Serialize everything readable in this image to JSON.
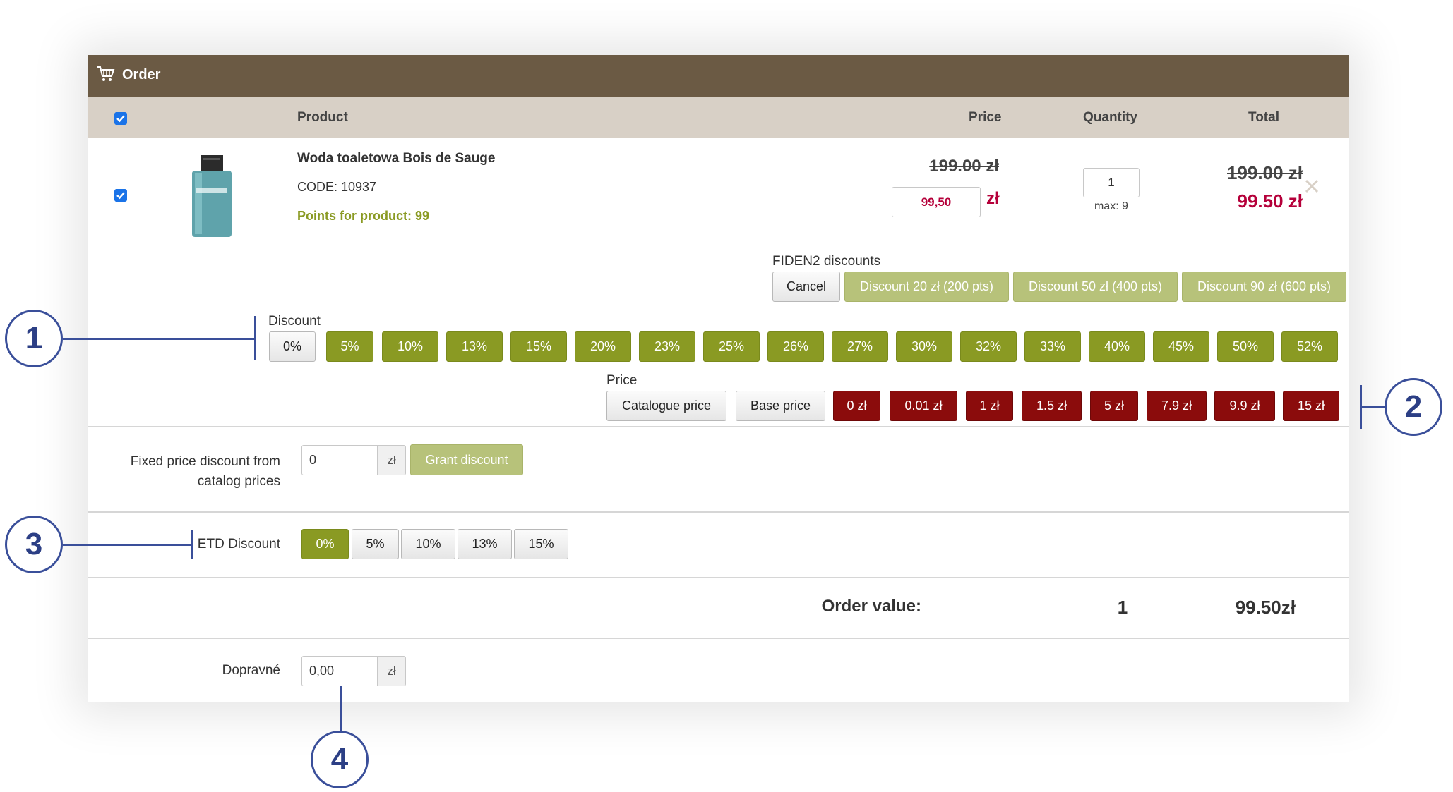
{
  "window": {
    "title": "Order"
  },
  "table_header": {
    "product": "Product",
    "price": "Price",
    "quantity": "Quantity",
    "total": "Total"
  },
  "product": {
    "name": "Woda toaletowa Bois de Sauge",
    "code": "CODE: 10937",
    "points": "Points for product: 99",
    "catalog_price": "199.00 zł",
    "price_input": "99,50",
    "currency": "zł",
    "quantity": "1",
    "max": "max: 9",
    "total_old": "199.00 zł",
    "total_new": "99.50 zł"
  },
  "fiden": {
    "label": "FIDEN2 discounts",
    "cancel": "Cancel",
    "options": [
      "Discount 20 zł (200 pts)",
      "Discount 50 zł (400 pts)",
      "Discount 90 zł (600 pts)"
    ]
  },
  "discount": {
    "label": "Discount",
    "options": [
      "0%",
      "5%",
      "10%",
      "13%",
      "15%",
      "20%",
      "23%",
      "25%",
      "26%",
      "27%",
      "30%",
      "32%",
      "33%",
      "40%",
      "45%",
      "50%",
      "52%"
    ]
  },
  "price_section": {
    "label": "Price",
    "catalogue": "Catalogue price",
    "base": "Base price",
    "options": [
      "0 zł",
      "0.01 zł",
      "1 zł",
      "1.5 zł",
      "5 zł",
      "7.9 zł",
      "9.9 zł",
      "15 zł"
    ]
  },
  "fixed_discount": {
    "label_line1": "Fixed price discount from",
    "label_line2": "catalog prices",
    "value": "0",
    "unit": "zł",
    "button": "Grant discount"
  },
  "etd": {
    "label": "ETD Discount",
    "options": [
      "0%",
      "5%",
      "10%",
      "13%",
      "15%"
    ],
    "selected": "0%"
  },
  "order_value": {
    "label": "Order value:",
    "quantity": "1",
    "total": "99.50zł"
  },
  "shipping": {
    "label": "Dopravné",
    "value": "0,00",
    "unit": "zł"
  },
  "callouts": [
    "1",
    "2",
    "3",
    "4"
  ],
  "colors": {
    "header": "#6b5a44",
    "olive": "#8a9a23",
    "light_olive": "#b7c27a",
    "dark_red": "#8b0c0c",
    "price_red": "#b5003a",
    "callout": "#3a4f9a"
  }
}
